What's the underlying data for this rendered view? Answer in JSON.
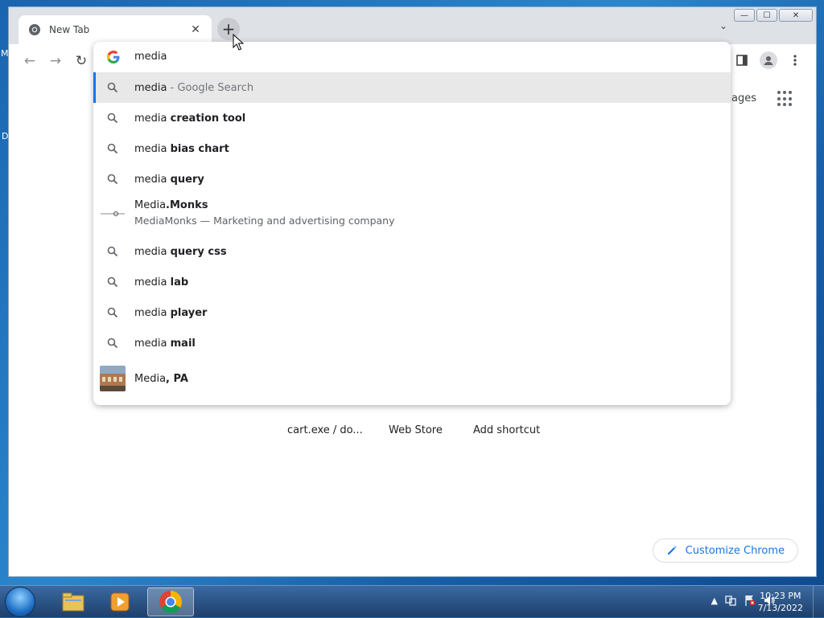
{
  "desktop": {
    "edge_labels": [
      "M",
      "D"
    ]
  },
  "browser": {
    "tab": {
      "title": "New Tab",
      "close_glyph": "✕"
    },
    "new_tab_glyph": "+",
    "tab_search_glyph": "⌄",
    "window_controls": {
      "minimize": "—",
      "maximize": "☐",
      "close": "✕"
    },
    "toolbar": {
      "back": "←",
      "forward": "→",
      "reload": "↻"
    },
    "omnibox": {
      "value": "media",
      "suggestions": [
        {
          "type": "search",
          "typed": "media",
          "completion": "",
          "suffix": " - Google Search",
          "selected": true
        },
        {
          "type": "search",
          "typed": "media ",
          "completion": "creation tool"
        },
        {
          "type": "search",
          "typed": "media ",
          "completion": "bias chart"
        },
        {
          "type": "search",
          "typed": "media ",
          "completion": "query"
        },
        {
          "type": "entity",
          "typed": "Media",
          "completion": ".Monks",
          "description": "MediaMonks — Marketing and advertising company"
        },
        {
          "type": "search",
          "typed": "media ",
          "completion": "query css"
        },
        {
          "type": "search",
          "typed": "media ",
          "completion": "lab"
        },
        {
          "type": "search",
          "typed": "media ",
          "completion": "player"
        },
        {
          "type": "search",
          "typed": "media ",
          "completion": "mail"
        },
        {
          "type": "place",
          "typed": "Media",
          "completion": ", PA"
        }
      ]
    },
    "ntp": {
      "images_link_partial": "nages",
      "shortcuts": [
        "cart.exe / do...",
        "Web Store",
        "Add shortcut"
      ],
      "customize_label": "Customize Chrome"
    }
  },
  "taskbar": {
    "clock_time": "10:23 PM",
    "clock_date": "7/13/2022",
    "tray_arrow": "▲"
  },
  "colors": {
    "accent": "#1a73e8",
    "selected_row": "#e8e8e8",
    "tabstrip": "#dee1e6"
  }
}
